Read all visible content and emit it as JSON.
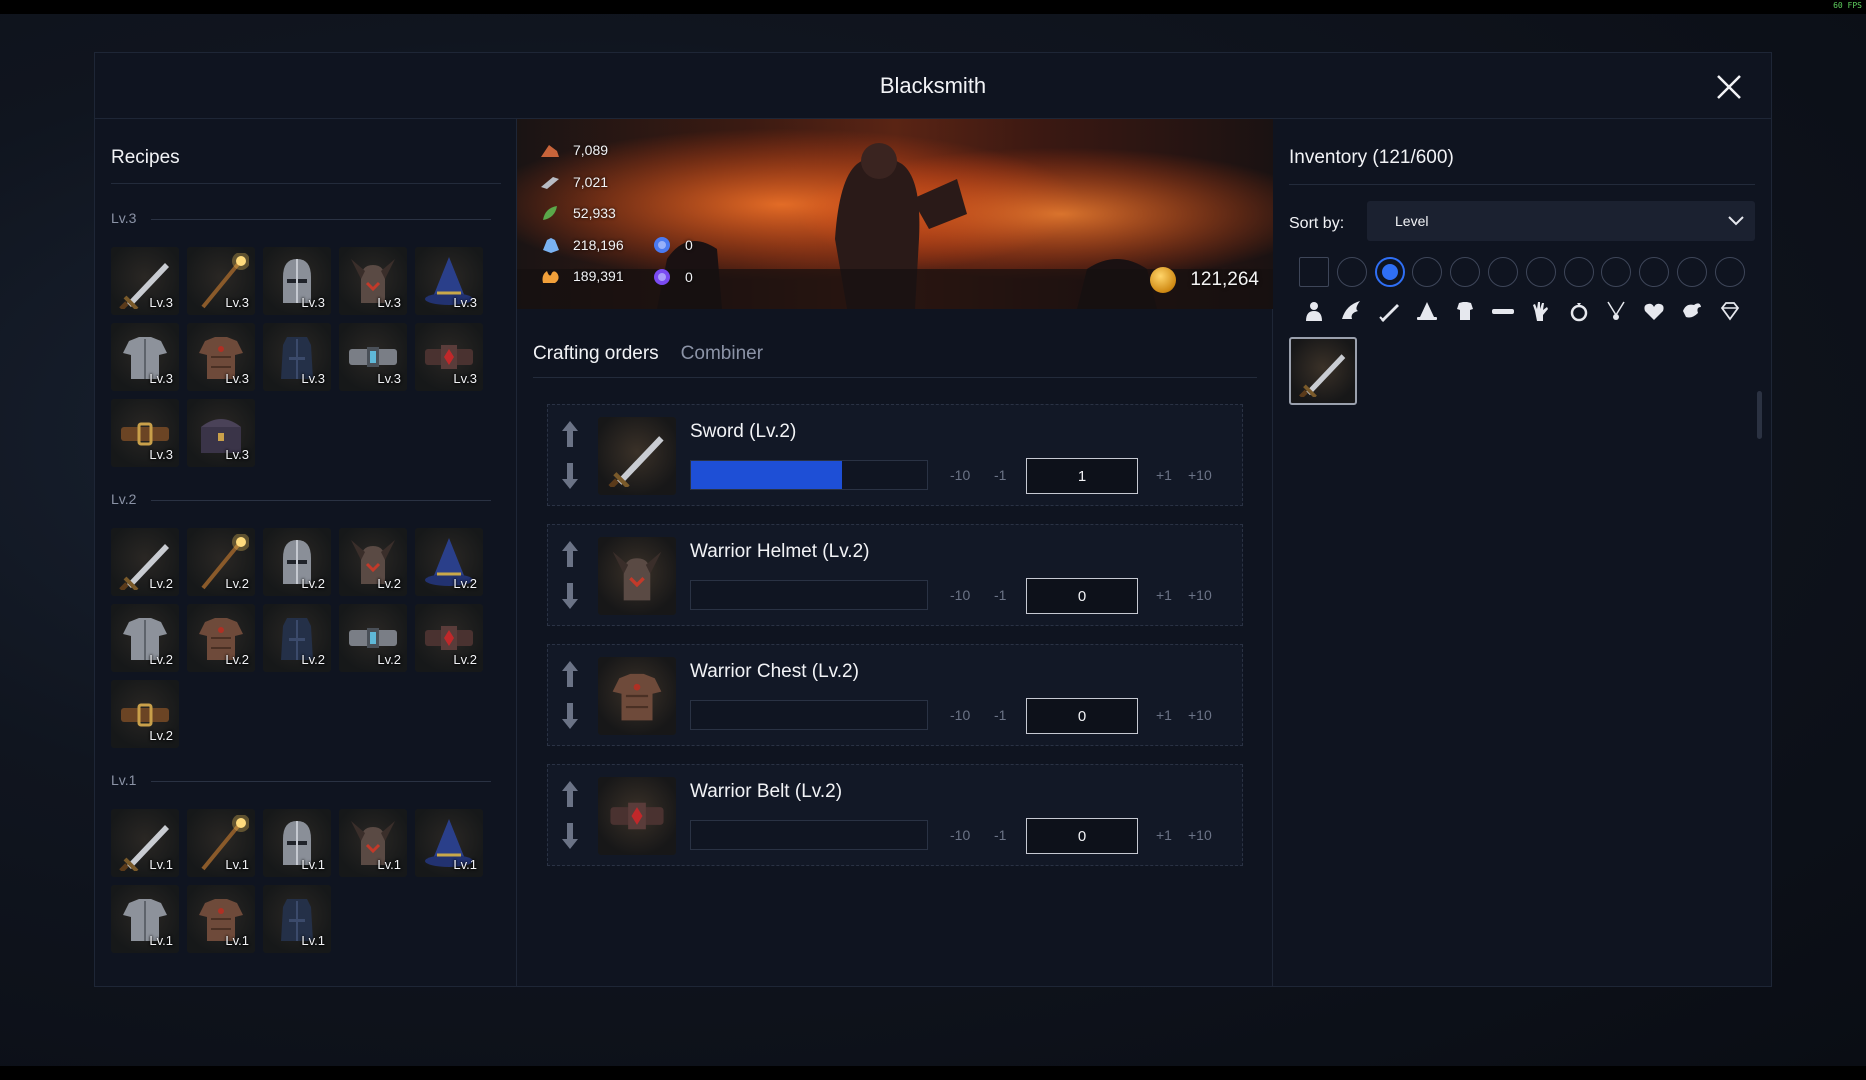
{
  "fps": "60 FPS",
  "modal": {
    "title": "Blacksmith"
  },
  "recipes": {
    "title": "Recipes",
    "groups": [
      {
        "heading": "Lv.3",
        "items": [
          {
            "icon": "sword-icon",
            "level": "Lv.3"
          },
          {
            "icon": "staff-icon",
            "level": "Lv.3"
          },
          {
            "icon": "knight-helmet-icon",
            "level": "Lv.3"
          },
          {
            "icon": "horned-helmet-icon",
            "level": "Lv.3"
          },
          {
            "icon": "wizard-hat-icon",
            "level": "Lv.3"
          },
          {
            "icon": "plate-armor-icon",
            "level": "Lv.3"
          },
          {
            "icon": "leather-armor-icon",
            "level": "Lv.3"
          },
          {
            "icon": "robe-icon",
            "level": "Lv.3"
          },
          {
            "icon": "gem-belt-icon",
            "level": "Lv.3"
          },
          {
            "icon": "ruby-belt-icon",
            "level": "Lv.3"
          },
          {
            "icon": "leather-belt-icon",
            "level": "Lv.3"
          },
          {
            "icon": "chest-icon",
            "level": "Lv.3"
          }
        ]
      },
      {
        "heading": "Lv.2",
        "items": [
          {
            "icon": "sword-icon",
            "level": "Lv.2"
          },
          {
            "icon": "staff-icon",
            "level": "Lv.2"
          },
          {
            "icon": "knight-helmet-icon",
            "level": "Lv.2"
          },
          {
            "icon": "horned-helmet-icon",
            "level": "Lv.2"
          },
          {
            "icon": "wizard-hat-icon",
            "level": "Lv.2"
          },
          {
            "icon": "plate-armor-icon",
            "level": "Lv.2"
          },
          {
            "icon": "leather-armor-icon",
            "level": "Lv.2"
          },
          {
            "icon": "robe-icon",
            "level": "Lv.2"
          },
          {
            "icon": "gem-belt-icon",
            "level": "Lv.2"
          },
          {
            "icon": "ruby-belt-icon",
            "level": "Lv.2"
          },
          {
            "icon": "leather-belt-icon",
            "level": "Lv.2"
          }
        ]
      },
      {
        "heading": "Lv.1",
        "items": [
          {
            "icon": "sword-icon",
            "level": "Lv.1"
          },
          {
            "icon": "staff-icon",
            "level": "Lv.1"
          },
          {
            "icon": "knight-helmet-icon",
            "level": "Lv.1"
          },
          {
            "icon": "horned-helmet-icon",
            "level": "Lv.1"
          },
          {
            "icon": "wizard-hat-icon",
            "level": "Lv.1"
          },
          {
            "icon": "plate-armor-icon",
            "level": "Lv.1"
          },
          {
            "icon": "leather-armor-icon",
            "level": "Lv.1"
          },
          {
            "icon": "robe-icon",
            "level": "Lv.1"
          }
        ]
      }
    ]
  },
  "resources": [
    {
      "icon": "ore-icon",
      "value": "7,089"
    },
    {
      "icon": "iron-bar-icon",
      "value": "7,021"
    },
    {
      "icon": "herb-icon",
      "value": "52,933"
    },
    {
      "icon": "crystal-icon",
      "value": "218,196"
    },
    {
      "icon": "fire-essence-icon",
      "value": "189,391"
    }
  ],
  "gems": [
    {
      "icon": "blue-gem-icon",
      "value": "0"
    },
    {
      "icon": "purple-gem-icon",
      "value": "0"
    }
  ],
  "gold": "121,264",
  "tabs": {
    "crafting": "Crafting orders",
    "combiner": "Combiner"
  },
  "steps": {
    "minus10": "-10",
    "minus1": "-1",
    "plus1": "+1",
    "plus10": "+10"
  },
  "orders": [
    {
      "name": "Sword (Lv.2)",
      "icon": "sword-icon",
      "progress": 0.64,
      "quantity": "1"
    },
    {
      "name": "Warrior Helmet (Lv.2)",
      "icon": "horned-helmet-icon",
      "progress": 0,
      "quantity": "0"
    },
    {
      "name": "Warrior Chest (Lv.2)",
      "icon": "leather-armor-icon",
      "progress": 0,
      "quantity": "0"
    },
    {
      "name": "Warrior Belt (Lv.2)",
      "icon": "ruby-belt-icon",
      "progress": 0,
      "quantity": "0"
    }
  ],
  "inventory": {
    "title": "Inventory (121/600)",
    "sort_label": "Sort by:",
    "sort_value": "Level",
    "selected_rarity_index": 2,
    "categories": [
      "bust-icon",
      "wing-icon",
      "sword-icon",
      "hat-icon",
      "armor-icon",
      "belt-icon",
      "glove-icon",
      "ring-icon",
      "amulet-icon",
      "heart-icon",
      "ornament-icon",
      "diamond-icon"
    ],
    "items": [
      {
        "icon": "sword-icon"
      }
    ]
  },
  "colors": {
    "accent": "#2f6ff5",
    "progress": "#1e4fd6"
  }
}
